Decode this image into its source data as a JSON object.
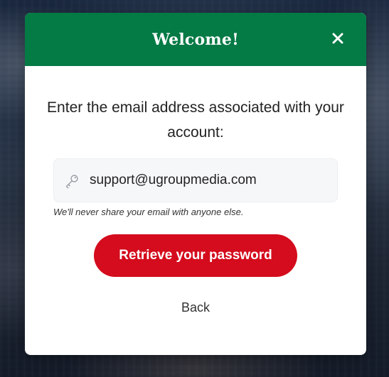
{
  "modal": {
    "title": "Welcome!",
    "close_icon": "close-icon",
    "prompt": "Enter the email address associated with your account:",
    "email": {
      "value": "support@ugroupmedia.com",
      "icon": "key-icon"
    },
    "help_text": "We'll never share your email with anyone else.",
    "retrieve_button_label": "Retrieve your password",
    "back_label": "Back"
  },
  "colors": {
    "header_green": "#047a45",
    "button_red": "#d40c1d",
    "field_background": "#f6f7f9"
  }
}
